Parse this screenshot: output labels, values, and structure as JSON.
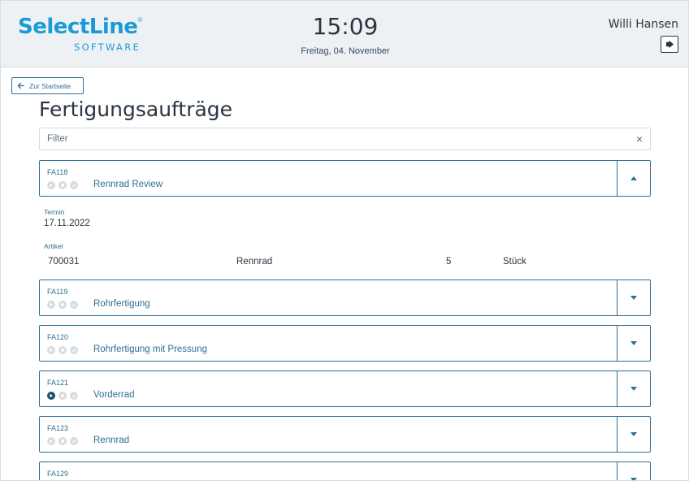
{
  "header": {
    "logo_main": "SelectLine",
    "logo_reg": "®",
    "logo_sub": "SOFTWARE",
    "time": "15:09",
    "date": "Freitag, 04. November",
    "user_name": "Willi Hansen",
    "logout_icon": "logout-icon"
  },
  "nav": {
    "back_label": "Zur Startseite"
  },
  "page": {
    "title": "Fertigungsaufträge"
  },
  "filter": {
    "placeholder": "Filter",
    "value": "",
    "clear_symbol": "×"
  },
  "colors": {
    "brand": "#1a9ad6",
    "accent": "#2e6f93",
    "header_bg": "#edf1f4",
    "status_inactive": "#d7dce1",
    "status_active": "#1d4f73"
  },
  "orders": [
    {
      "number": "FA118",
      "name": "Rennrad Review",
      "expanded": true,
      "status": [
        "inactive",
        "inactive",
        "inactive"
      ]
    },
    {
      "number": "FA119",
      "name": "Rohrfertigung",
      "expanded": false,
      "status": [
        "inactive",
        "inactive",
        "inactive"
      ]
    },
    {
      "number": "FA120",
      "name": "Rohrfertigung mit Pressung",
      "expanded": false,
      "status": [
        "inactive",
        "inactive",
        "inactive"
      ]
    },
    {
      "number": "FA121",
      "name": "Vorderrad",
      "expanded": false,
      "status": [
        "active",
        "inactive",
        "inactive"
      ]
    },
    {
      "number": "FA123",
      "name": "Rennrad",
      "expanded": false,
      "status": [
        "inactive",
        "inactive",
        "inactive"
      ]
    },
    {
      "number": "FA129",
      "name": "",
      "expanded": false,
      "status": [
        "inactive",
        "inactive",
        "inactive"
      ]
    }
  ],
  "detail": {
    "termin_label": "Termin",
    "termin_value": "17.11.2022",
    "artikel_label": "Artikel",
    "artikel_number": "700031",
    "artikel_name": "Rennrad",
    "artikel_qty": "5",
    "artikel_unit": "Stück"
  }
}
